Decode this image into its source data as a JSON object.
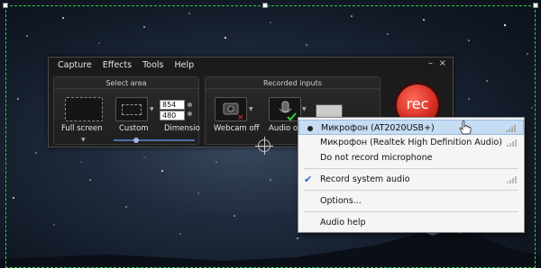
{
  "menubar": {
    "items": [
      "Capture",
      "Effects",
      "Tools",
      "Help"
    ]
  },
  "window_controls": {
    "minimize": "–",
    "close": "×"
  },
  "select_area": {
    "title": "Select area",
    "full_screen_label": "Full screen",
    "custom_label": "Custom",
    "dimension_label": "Dimensio",
    "width_value": "854",
    "height_value": "480"
  },
  "recorded_inputs": {
    "title": "Recorded inputs",
    "webcam_label": "Webcam off",
    "audio_label": "Audio on"
  },
  "rec_button": {
    "label": "rec"
  },
  "audio_menu": {
    "items": [
      {
        "label": "Микрофон (AT2020USB+)",
        "selected": true,
        "highlighted": true
      },
      {
        "label": "Микрофон (Realtek High Definition Audio)"
      },
      {
        "label": "Do not record microphone"
      },
      {
        "label": "Record system audio",
        "checked": true
      },
      {
        "label": "Options..."
      },
      {
        "label": "Audio help"
      }
    ]
  },
  "colors": {
    "selection_border": "#2ecc40",
    "rec_red": "#d42a1e",
    "highlight": "#c6dcf2"
  }
}
